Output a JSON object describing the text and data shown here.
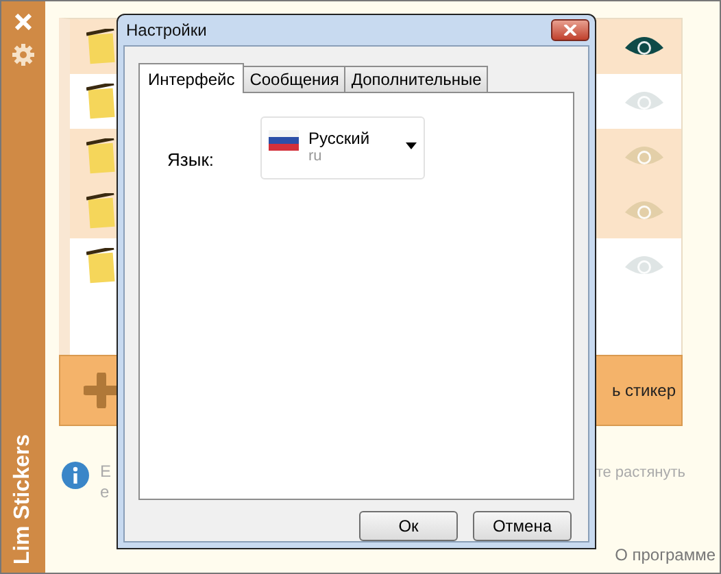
{
  "sidebar": {
    "title": "Lim Stickers"
  },
  "stickers": [
    {
      "highlighted": true,
      "visible": true
    },
    {
      "highlighted": false,
      "visible": false
    },
    {
      "highlighted": true,
      "visible": false
    },
    {
      "highlighted": true,
      "visible": false
    },
    {
      "highlighted": false,
      "visible": false
    }
  ],
  "add_button": {
    "label": "ь стикер"
  },
  "hint": {
    "left_lines": [
      "Е",
      "е"
    ],
    "right_text": "те растянуть"
  },
  "about_link": "О программе",
  "dialog": {
    "title": "Настройки",
    "tabs": [
      {
        "label": "Интерфейс",
        "selected": true
      },
      {
        "label": "Сообщения",
        "selected": false
      },
      {
        "label": "Дополнительные",
        "selected": false
      }
    ],
    "language_label": "Язык:",
    "language": {
      "name": "Русский",
      "code": "ru"
    },
    "buttons": [
      "Ок",
      "Отмена"
    ]
  }
}
